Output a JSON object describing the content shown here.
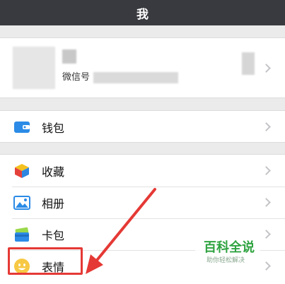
{
  "header": {
    "title": "我"
  },
  "profile": {
    "wechat_id_label": "微信号"
  },
  "wallet_group": {
    "items": [
      {
        "label": "钱包",
        "icon": "wallet-icon",
        "color": "#2b8be6"
      }
    ]
  },
  "main_group": {
    "items": [
      {
        "label": "收藏",
        "icon": "favorites-cube-icon"
      },
      {
        "label": "相册",
        "icon": "album-icon"
      },
      {
        "label": "卡包",
        "icon": "card-package-icon"
      },
      {
        "label": "表情",
        "icon": "sticker-smiley-icon"
      }
    ]
  },
  "watermark": {
    "title": "百科全说",
    "subtitle": "助你轻松解决"
  },
  "colors": {
    "header_bg": "#393a3f",
    "annotation": "#e53935",
    "watermark_green": "#2fa341"
  }
}
